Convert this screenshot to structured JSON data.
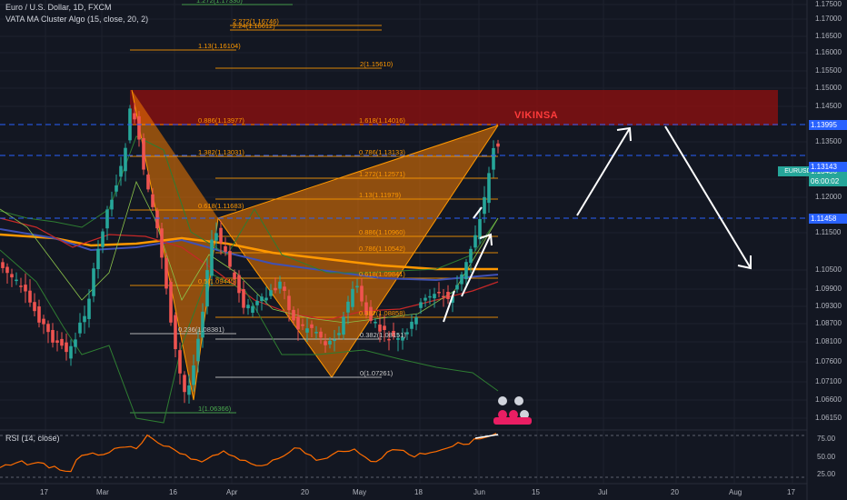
{
  "header": {
    "symbol_line": "Euro / U.S. Dollar, 1D, FXCM",
    "indicator_line": "VATA MA Cluster Algo (15, close, 20, 2)",
    "rsi_label": "RSI (14, close)"
  },
  "watermark": "VIKINSA",
  "symbol_tag": "EURUSD",
  "price_axis": [
    "1.17500",
    "1.17000",
    "1.16500",
    "1.16000",
    "1.15500",
    "1.15000",
    "1.14500",
    "1.13500",
    "1.12500",
    "1.12000",
    "1.11500",
    "1.10500",
    "1.09900",
    "1.09300",
    "1.08700",
    "1.08100",
    "1.07600",
    "1.07100",
    "1.06600",
    "1.06150"
  ],
  "price_tags": [
    {
      "text": "1.13995",
      "color": "#2962ff"
    },
    {
      "text": "1.13436",
      "color": "#26a69a"
    },
    {
      "text": "06:00:02",
      "color": "#26a69a"
    },
    {
      "text": "1.13143",
      "color": "#2962ff"
    },
    {
      "text": "1.11458",
      "color": "#2962ff"
    }
  ],
  "rsi_axis": [
    "75.00",
    "50.00",
    "25.00"
  ],
  "time_axis": [
    "17",
    "Mar",
    "16",
    "Apr",
    "20",
    "May",
    "18",
    "Jun",
    "15",
    "Jul",
    "20",
    "Aug",
    "17"
  ],
  "fib_labels": [
    {
      "text": "1.272(1.17330)",
      "color": "#4caf50"
    },
    {
      "text": "2.272(1.16746)",
      "color": "#ff9800"
    },
    {
      "text": "2.24(1.16612)",
      "color": "#ff9800"
    },
    {
      "text": "1.13(1.16104)",
      "color": "#ff9800"
    },
    {
      "text": "2(1.15610)",
      "color": "#ff9800"
    },
    {
      "text": "1.618(1.14016)",
      "color": "#ff9800"
    },
    {
      "text": "0.886(1.13977)",
      "color": "#ff9800"
    },
    {
      "text": "0.786(1.13133)",
      "color": "#ff9800"
    },
    {
      "text": "1.382(1.13031)",
      "color": "#ff9800"
    },
    {
      "text": "1.272(1.12571)",
      "color": "#ff9800"
    },
    {
      "text": "1.13(1.11979)",
      "color": "#ff9800"
    },
    {
      "text": "0.618(1.11683)",
      "color": "#ff9800"
    },
    {
      "text": "0.886(1.10960)",
      "color": "#ff9800"
    },
    {
      "text": "0.786(1.10542)",
      "color": "#ff9800"
    },
    {
      "text": "0.618(1.09841)",
      "color": "#ff9800"
    },
    {
      "text": "0.5(1.09445)",
      "color": "#ff9800"
    },
    {
      "text": "0.382(1.08858)",
      "color": "#ff9800"
    },
    {
      "text": "0.236(1.08381)",
      "color": "#cccccc"
    },
    {
      "text": "0.382(1.08151)",
      "color": "#cccccc"
    },
    {
      "text": "0(1.07261)",
      "color": "#cccccc"
    },
    {
      "text": "1(1.06366)",
      "color": "#4caf50"
    }
  ],
  "colors": {
    "background": "#131722",
    "up": "#26a69a",
    "down": "#ef5350",
    "pattern_fill": "#f57c00",
    "zone_fill": "#b71c1c",
    "rsi_line": "#ff6d00",
    "dash_line": "#2962ff"
  }
}
